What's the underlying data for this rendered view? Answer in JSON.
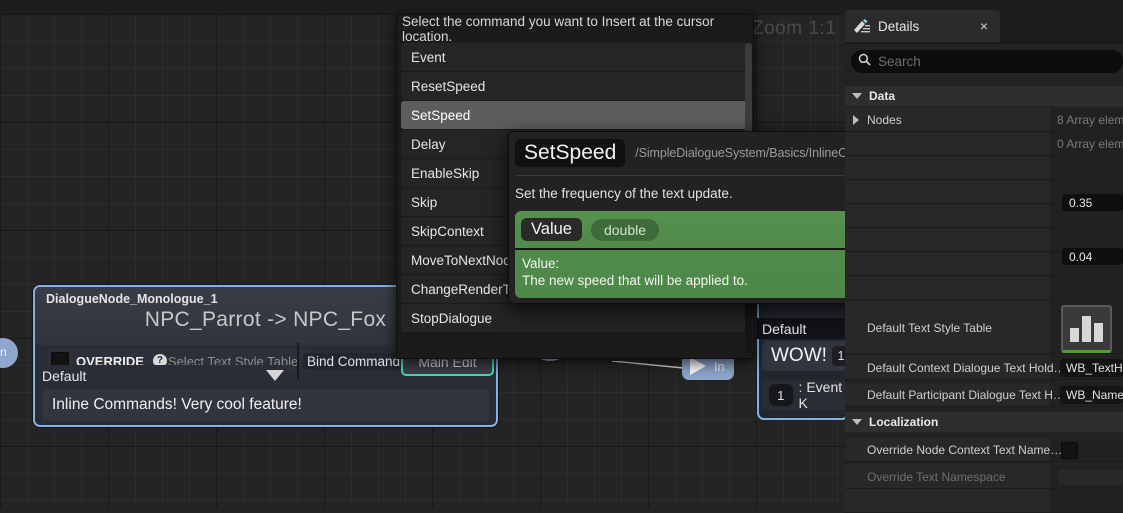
{
  "canvas": {
    "zoom_label": "Zoom 1:1",
    "left_pin_label": "n"
  },
  "dialogue_node": {
    "id": "DialogueNode_Monologue_1",
    "title": "NPC_Parrot -> NPC_Fox",
    "override_label": "OVERRIDE",
    "help_icon_glyph": "?",
    "style_table_label": "Select Text Style Table",
    "combo_value": "Default",
    "bind_command_label": "Bind Command",
    "main_edit_label": "Main Edit",
    "body_text": "Inline Commands! Very cool feature!"
  },
  "mid_node": {
    "in_pin_label": "In"
  },
  "event_node": {
    "default_label": "Default",
    "wow_text": "WOW!",
    "wow_badge": "1",
    "key_badge": "1",
    "key_label": ": Event K"
  },
  "command_list": {
    "prompt": "Select the command you want to Insert at the cursor location.",
    "items": [
      {
        "label": "Event",
        "selected": false
      },
      {
        "label": "ResetSpeed",
        "selected": false
      },
      {
        "label": "SetSpeed",
        "selected": true
      },
      {
        "label": "Delay",
        "selected": false
      },
      {
        "label": "EnableSkip",
        "selected": false
      },
      {
        "label": "Skip",
        "selected": false
      },
      {
        "label": "SkipContext",
        "selected": false
      },
      {
        "label": "MoveToNextNod",
        "selected": false
      },
      {
        "label": "ChangeRenderType",
        "selected": false
      },
      {
        "label": "StopDialogue",
        "selected": false
      }
    ]
  },
  "tooltip": {
    "title": "SetSpeed",
    "path": "/SimpleDialogueSystem/Basics/InlineCommand/Common/DI_SetSpeed.DI_SetSpeed_C",
    "description": "Set the frequency of the text update.",
    "param_name": "Value",
    "param_type": "double",
    "param_desc_line1": "Value:",
    "param_desc_line2": "The new speed that will be applied to.",
    "accent": "#4e8849"
  },
  "details": {
    "tab_label": "Details",
    "close_glyph": "×",
    "search_placeholder": "Search",
    "categories": {
      "data": "Data",
      "localization": "Localization"
    },
    "rows": [
      {
        "name": "Nodes",
        "value": "8 Array elem",
        "expandable": true
      },
      {
        "name": "",
        "value": "0 Array elem",
        "expandable": false
      },
      {
        "name": "",
        "value": "",
        "expandable": false
      },
      {
        "name": "",
        "value": "",
        "expandable": false
      },
      {
        "name": "",
        "value": "",
        "expandable": false
      },
      {
        "name": "",
        "value": "",
        "expandable": false
      },
      {
        "name": "Default Text Style Table",
        "value": "",
        "expandable": false
      },
      {
        "name": "Default Context Dialogue Text Hold…",
        "value": "",
        "expandable": false
      },
      {
        "name": "Default Participant Dialogue Text H…",
        "value": "",
        "expandable": false
      },
      {
        "name": "Override Node Context Text Name…",
        "value": "",
        "expandable": false
      },
      {
        "name": "Override Text Namespace",
        "value": "",
        "expandable": false,
        "dim": true
      }
    ],
    "numbers": {
      "speed": "0.35",
      "interval": "0.04"
    },
    "assets": {
      "text_holder": "WB_TextHo",
      "name_holder": "WB_Name_"
    }
  }
}
